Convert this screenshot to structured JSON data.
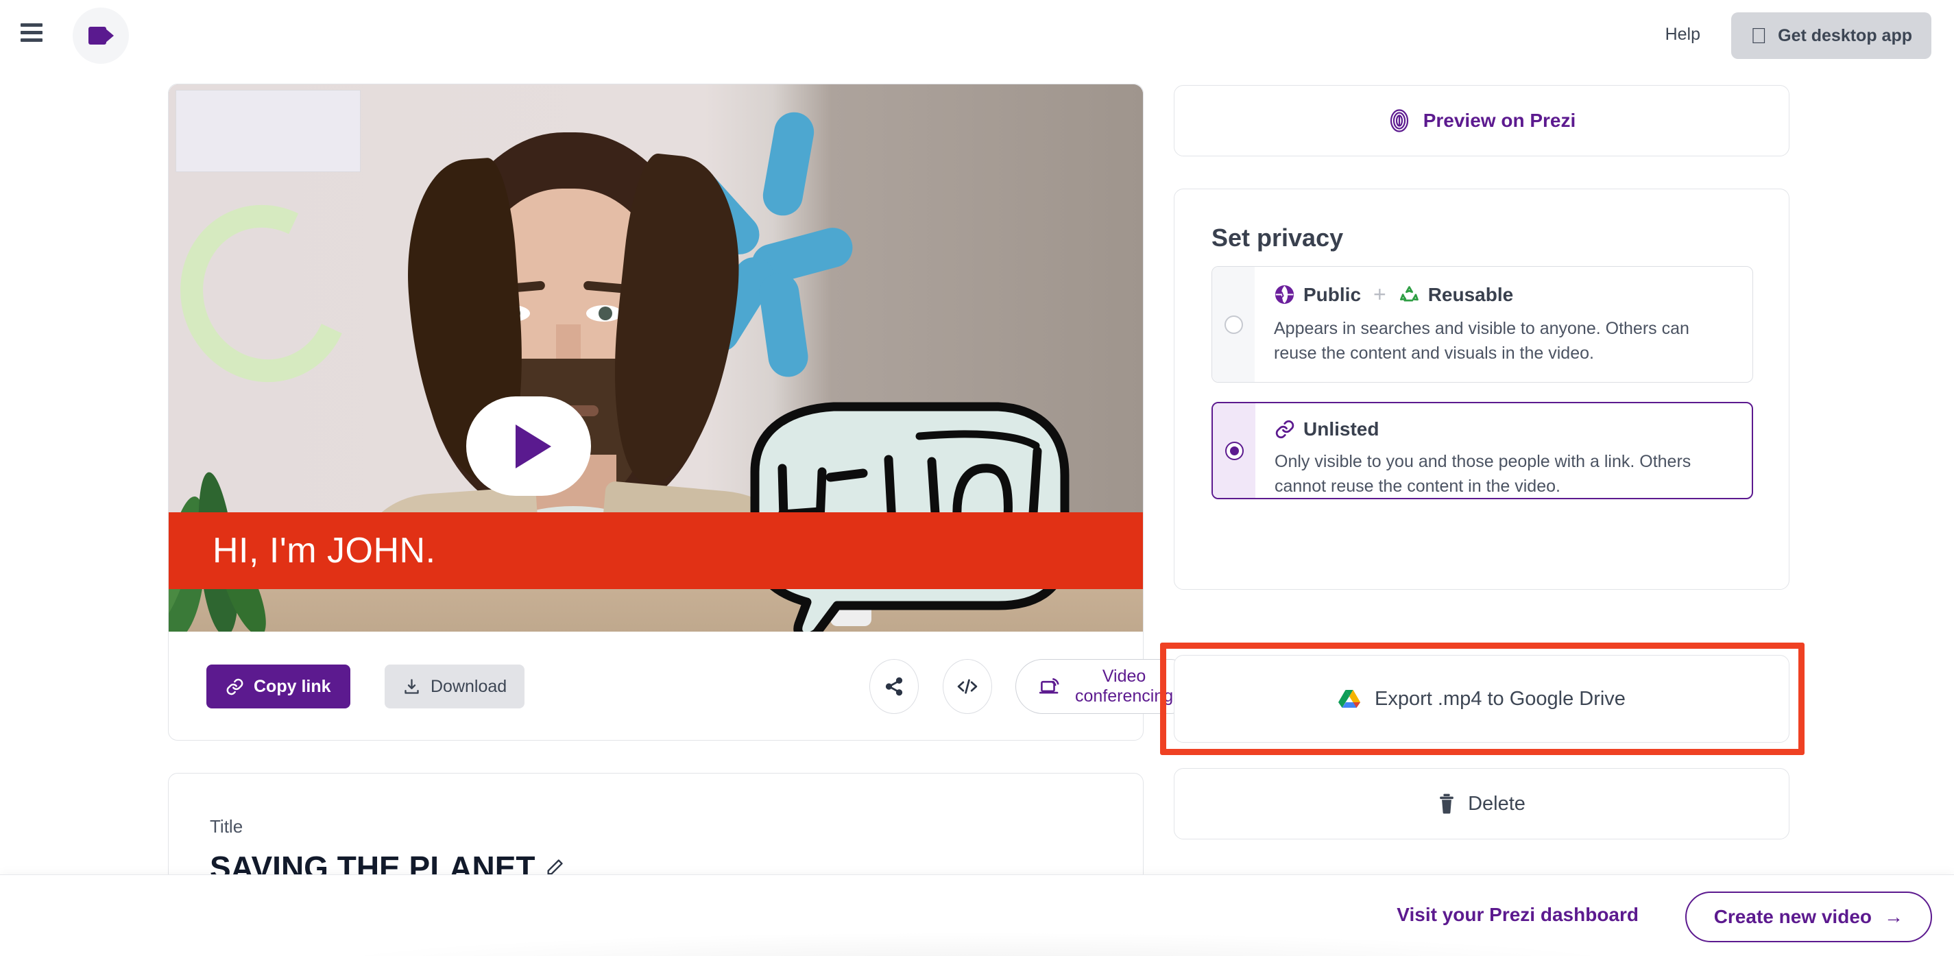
{
  "header": {
    "menu_icon": "hamburger-menu-icon",
    "logo_icon": "video-camera-logo-icon",
    "help_label": "Help",
    "desktop_app_label": "Get desktop app",
    "desktop_app_icon": "apple-logo-icon"
  },
  "video": {
    "play_icon": "play-button-icon",
    "caption": "HI, I'm JOHN.",
    "bubble_text": "HELLO!",
    "actions": {
      "copy_link_label": "Copy link",
      "copy_link_icon": "link-icon",
      "download_label": "Download",
      "download_icon": "download-icon",
      "share_icon": "share-icon",
      "embed_icon": "embed-code-icon",
      "video_conferencing_label": "Video conferencing",
      "video_conferencing_icon": "screen-broadcast-icon"
    }
  },
  "title_card": {
    "label": "Title",
    "value": "SAVING THE PLANET",
    "edit_icon": "pencil-edit-icon"
  },
  "sidebar": {
    "preview": {
      "label": "Preview on Prezi",
      "icon": "prezi-logo-icon"
    },
    "privacy": {
      "heading": "Set privacy",
      "options": [
        {
          "id": "public-reusable",
          "label_a": "Public",
          "icon_a": "globe-icon",
          "plus": "+",
          "label_b": "Reusable",
          "icon_b": "recycle-icon",
          "description": "Appears in searches and visible to anyone. Others can reuse the content and visuals in the video.",
          "selected": false
        },
        {
          "id": "unlisted",
          "label_a": "Unlisted",
          "icon_a": "link-icon",
          "description": "Only visible to you and those people with a link. Others cannot reuse the content in the video.",
          "selected": true
        }
      ]
    },
    "export": {
      "label": "Export .mp4 to Google Drive",
      "icon": "google-drive-icon",
      "highlighted": true,
      "highlight_color": "#ef4123"
    },
    "delete": {
      "label": "Delete",
      "icon": "trash-icon"
    }
  },
  "footer": {
    "dashboard_link": "Visit your Prezi dashboard",
    "create_label": "Create new video",
    "create_arrow": "→"
  },
  "colors": {
    "brand_purple": "#5c1a8f",
    "caption_red": "#e13115",
    "annotation_red": "#ef4123",
    "text_dark": "#3d4654"
  }
}
